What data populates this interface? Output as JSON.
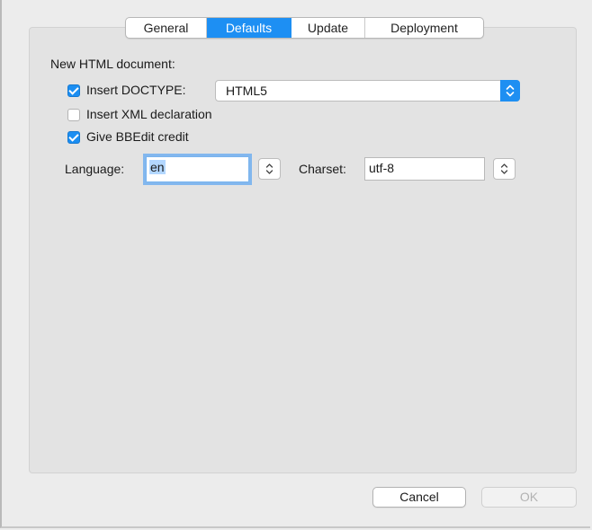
{
  "tabs": [
    {
      "label": "General",
      "active": false
    },
    {
      "label": "Defaults",
      "active": true
    },
    {
      "label": "Update",
      "active": false
    },
    {
      "label": "Deployment",
      "active": false
    }
  ],
  "section": {
    "title": "New HTML document:"
  },
  "options": {
    "insert_doctype": {
      "label": "Insert DOCTYPE:",
      "checked": true
    },
    "insert_xml": {
      "label": "Insert XML declaration",
      "checked": false
    },
    "bbedit_credit": {
      "label": "Give BBEdit credit",
      "checked": true
    }
  },
  "doctype_popup": {
    "value": "HTML5",
    "icon": "up-down-chevron-icon"
  },
  "language": {
    "label": "Language:",
    "value": "en"
  },
  "charset": {
    "label": "Charset:",
    "value": "utf-8"
  },
  "buttons": {
    "cancel": "Cancel",
    "ok": "OK"
  },
  "colors": {
    "accent": "#1d8ff3",
    "panel": "#e3e3e3",
    "window": "#ececec"
  }
}
